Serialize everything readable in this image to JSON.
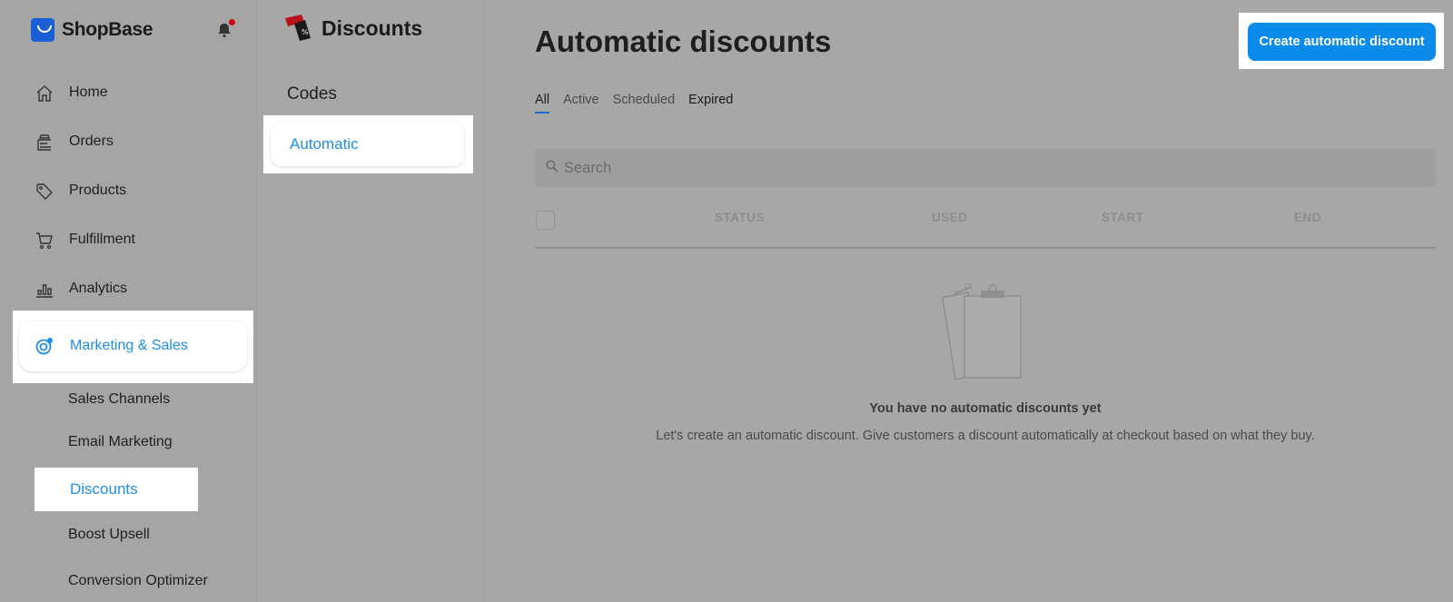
{
  "brand": {
    "name": "ShopBase"
  },
  "sidebar": {
    "items": [
      {
        "label": "Home",
        "icon": "home-icon"
      },
      {
        "label": "Orders",
        "icon": "orders-icon"
      },
      {
        "label": "Products",
        "icon": "tag-icon"
      },
      {
        "label": "Fulfillment",
        "icon": "cart-icon"
      },
      {
        "label": "Analytics",
        "icon": "analytics-icon"
      },
      {
        "label": "Marketing & Sales",
        "icon": "target-icon",
        "active": true
      }
    ],
    "sub_items": [
      {
        "label": "Sales Channels"
      },
      {
        "label": "Email Marketing"
      },
      {
        "label": "Discounts",
        "active": true
      },
      {
        "label": "Boost Upsell"
      },
      {
        "label": "Conversion Optimizer"
      }
    ]
  },
  "discounts_nav": {
    "title": "Discounts",
    "items": [
      {
        "label": "Codes"
      },
      {
        "label": "Automatic",
        "active": true
      }
    ]
  },
  "main": {
    "title": "Automatic discounts",
    "create_button": "Create automatic discount",
    "tabs": [
      {
        "label": "All",
        "active": true
      },
      {
        "label": "Active"
      },
      {
        "label": "Scheduled"
      },
      {
        "label": "Expired"
      }
    ],
    "search": {
      "placeholder": "Search"
    },
    "table": {
      "columns": [
        "STATUS",
        "USED",
        "START",
        "END"
      ]
    },
    "empty": {
      "title": "You have no automatic discounts yet",
      "description": "Let's create an automatic discount. Give customers a discount automatically at checkout based on what they buy."
    }
  },
  "colors": {
    "accent": "#1e8ee8",
    "primary_button": "#0b8bea",
    "overlay": "#a7a7a7"
  }
}
